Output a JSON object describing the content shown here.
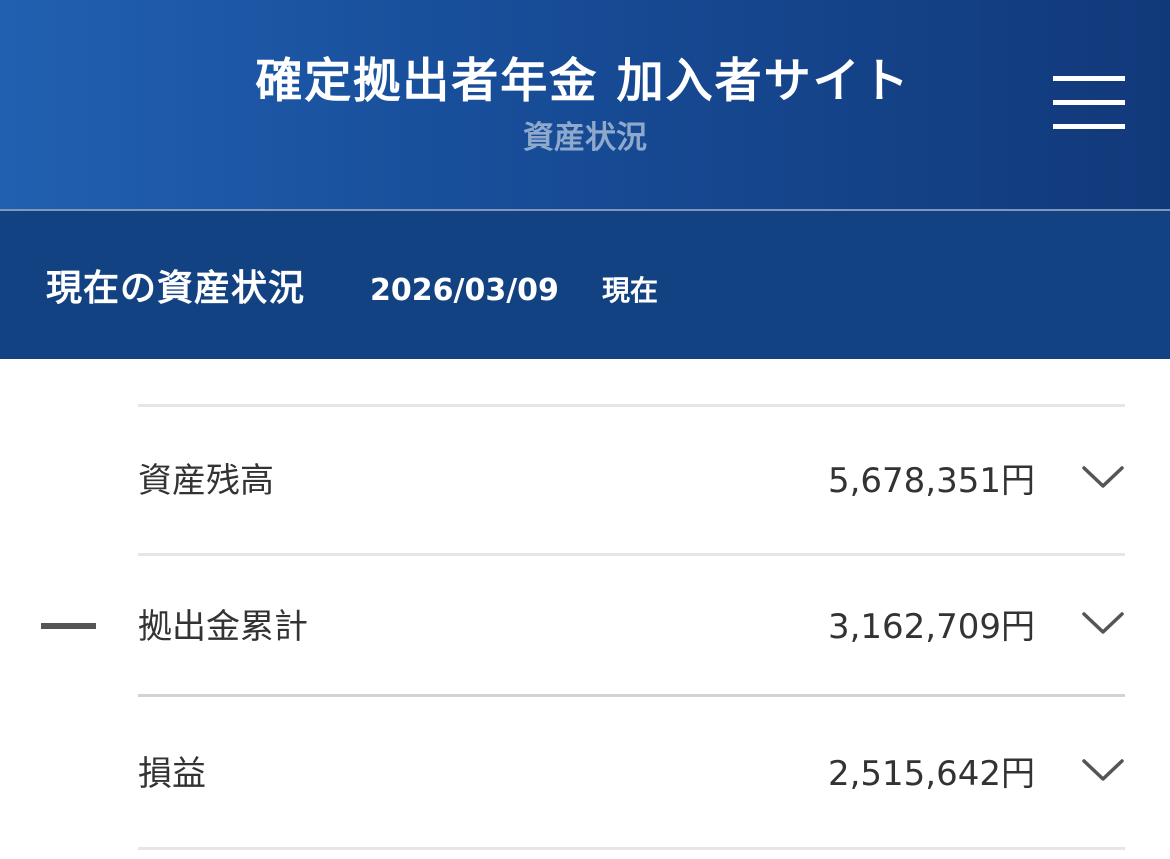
{
  "header": {
    "title": "確定拠出者年金 加入者サイト",
    "subtitle": "資産状況",
    "menu_icon": "hamburger-menu-icon"
  },
  "status": {
    "title": "現在の資産状況",
    "date": "2026/03/09",
    "suffix": "現在"
  },
  "summary": {
    "rows": [
      {
        "label": "資産残高",
        "value": "5,678,351円",
        "icon": "chevron-down-icon"
      },
      {
        "label": "拠出金累計",
        "value": "3,162,709円",
        "icon": "chevron-down-icon",
        "operator": "minus"
      },
      {
        "label": "損益",
        "value": "2,515,642円",
        "icon": "chevron-down-icon"
      }
    ]
  },
  "colors": {
    "header_gradient_start": "#2160b0",
    "header_gradient_end": "#11397a",
    "status_bar": "#134283",
    "text": "#333333",
    "subtitle": "#8fa9cc"
  }
}
